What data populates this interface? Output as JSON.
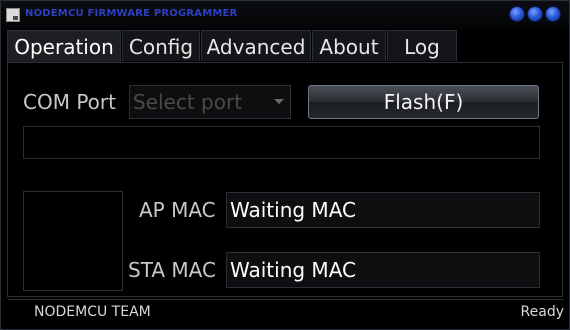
{
  "window": {
    "title": "NODEMCU FIRMWARE PROGRAMMER",
    "icon": "app-icon",
    "controls": [
      "minimize-button",
      "maximize-button",
      "close-button"
    ]
  },
  "tabs": [
    {
      "label": "Operation",
      "active": true
    },
    {
      "label": "Config",
      "active": false
    },
    {
      "label": "Advanced",
      "active": false
    },
    {
      "label": "About",
      "active": false
    },
    {
      "label": "Log",
      "active": false
    }
  ],
  "operation": {
    "com_port_label": "COM Port",
    "com_port_placeholder": "Select port",
    "flash_button_label": "Flash(F)",
    "ap_mac_label": "AP MAC",
    "ap_mac_value": "Waiting MAC",
    "sta_mac_label": "STA MAC",
    "sta_mac_value": "Waiting MAC"
  },
  "status": {
    "left": "NODEMCU TEAM",
    "right": "Ready"
  },
  "colors": {
    "title_text": "#2f3fc2",
    "window_buttons": "#2c59d8",
    "background": "#000000"
  }
}
